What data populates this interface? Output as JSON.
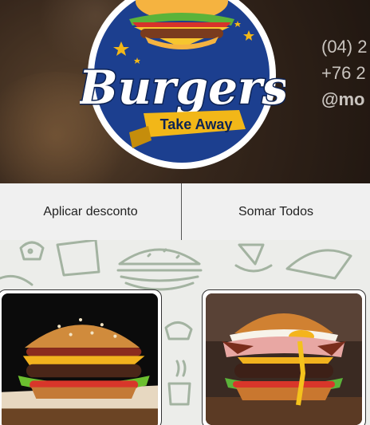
{
  "header": {
    "logo_title": "Burgers",
    "logo_subtitle": "Take Away",
    "phone_1": "(04) 2",
    "phone_2": "+76 2",
    "instagram": "@mo"
  },
  "actions": {
    "discount_label": "Aplicar desconto",
    "sum_label": "Somar Todos"
  },
  "products": [
    {
      "image": "cheeseburger-bacon-photo"
    },
    {
      "image": "egg-ham-burger-photo"
    }
  ],
  "colors": {
    "logo_blue": "#1c3f8f",
    "logo_yellow": "#f2b718",
    "doodle_green": "#a3b3a1",
    "background": "#ecedea"
  }
}
